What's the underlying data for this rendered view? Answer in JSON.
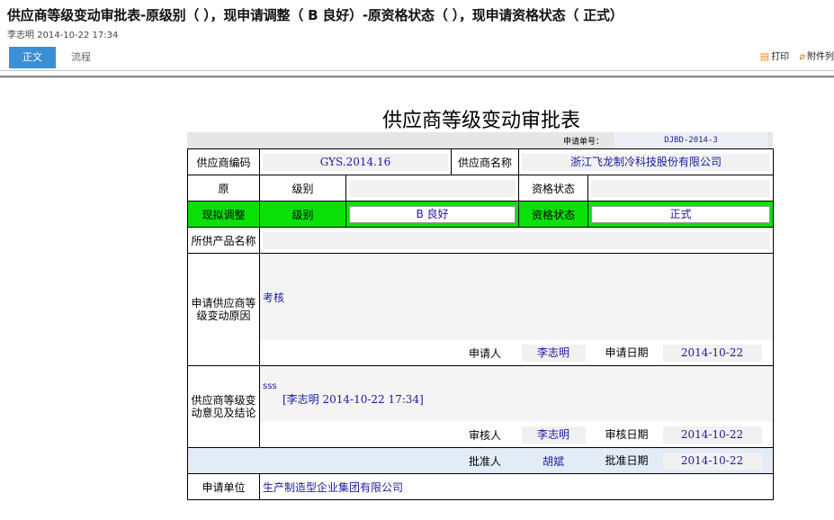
{
  "header": {
    "title": "供应商等级变动审批表-原级别（ ），现申请调整（ B 良好）-原资格状态（ ），现申请资格状态（ 正式）",
    "author": "李志明",
    "datetime": "2014-10-22 17:34"
  },
  "tabs": [
    {
      "label": "正文",
      "active": true
    },
    {
      "label": "流程",
      "active": false
    }
  ],
  "toolbar": {
    "print": "打印",
    "attach": "附件列"
  },
  "form": {
    "title": "供应商等级变动审批表",
    "app_no_label": "申请单号：",
    "app_no": "DJBD-2014-3",
    "supplier_code_label": "供应商编码",
    "supplier_code": "GYS.2014.16",
    "supplier_name_label": "供应商名称",
    "supplier_name": "浙江飞龙制冷科技股份有限公司",
    "orig_label": "原",
    "level_label": "级别",
    "status_label": "资格状态",
    "orig_level": "",
    "orig_status": "",
    "adjust_label": "现拟调整",
    "new_level": "B 良好",
    "new_status": "正式",
    "products_label": "所供产品名称",
    "products": "",
    "reason_label": "申请供应商等级变动原因",
    "reason_text": "考核",
    "applicant_label": "申请人",
    "applicant": "李志明",
    "apply_date_label": "申请日期",
    "apply_date": "2014-10-22",
    "opinion_label": "供应商等级变动意见及结论",
    "opinion_text": "sss",
    "opinion_sign": "[李志明 2014-10-22 17:34]",
    "reviewer_label": "审核人",
    "reviewer": "李志明",
    "review_date_label": "审核日期",
    "review_date": "2014-10-22",
    "approver_label": "批准人",
    "approver": "胡斌",
    "approve_date_label": "批准日期",
    "approve_date": "2014-10-22",
    "unit_label": "申请单位",
    "unit": "生产制造型企业集团有限公司"
  },
  "colors": {
    "accent": "#3b8fd4",
    "highlight_green": "#08e008",
    "value_blue": "#1a1aa0"
  }
}
